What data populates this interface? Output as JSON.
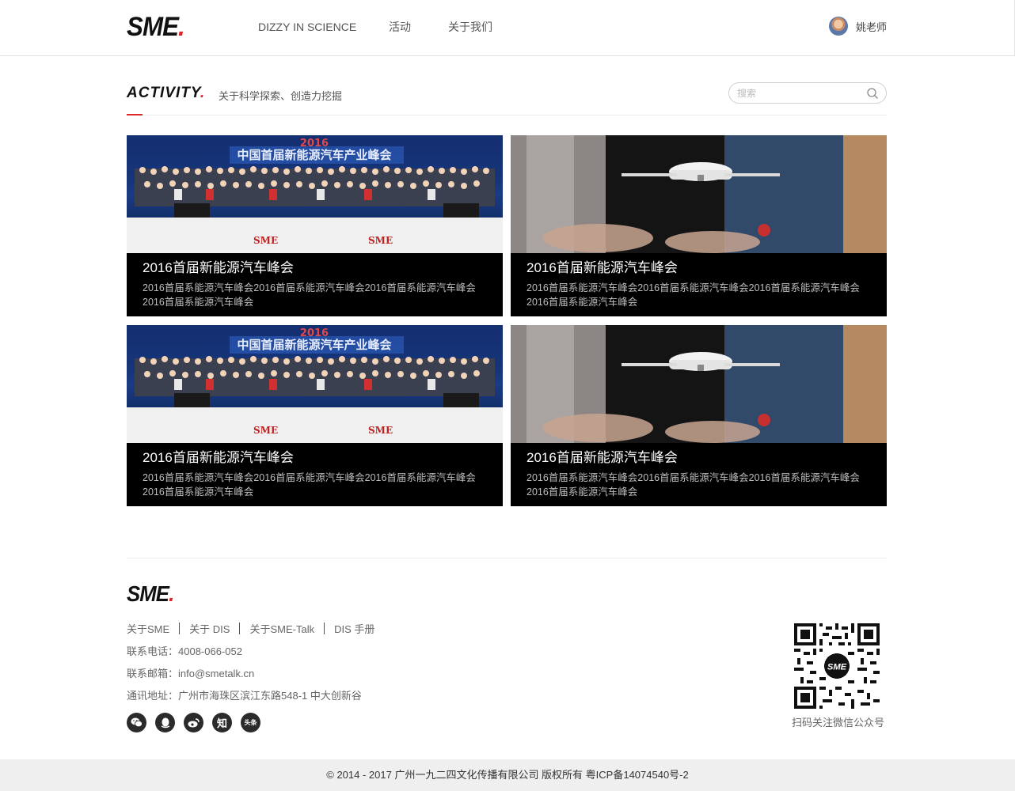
{
  "header": {
    "logo_text": "SME",
    "logo_dot": ".",
    "nav": [
      "DIZZY IN SCIENCE",
      "活动",
      "关于我们"
    ],
    "user_name": "姚老师"
  },
  "section": {
    "title": "ACTIVITY",
    "title_dot": ".",
    "subtitle": "关于科学探索、创造力挖掘",
    "search_placeholder": "搜索"
  },
  "cards": [
    {
      "title": "2016首届新能源汽车峰会",
      "desc": "2016首届系能源汽车峰会2016首届系能源汽车峰会2016首届系能源汽车峰会2016首届系能源汽车峰会",
      "image": "group-photo"
    },
    {
      "title": "2016首届新能源汽车峰会",
      "desc": "2016首届系能源汽车峰会2016首届系能源汽车峰会2016首届系能源汽车峰会2016首届系能源汽车峰会",
      "image": "drone-photo"
    },
    {
      "title": "2016首届新能源汽车峰会",
      "desc": "2016首届系能源汽车峰会2016首届系能源汽车峰会2016首届系能源汽车峰会2016首届系能源汽车峰会",
      "image": "group-photo"
    },
    {
      "title": "2016首届新能源汽车峰会",
      "desc": "2016首届系能源汽车峰会2016首届系能源汽车峰会2016首届系能源汽车峰会2016首届系能源汽车峰会",
      "image": "drone-photo"
    }
  ],
  "footer": {
    "logo_text": "SME",
    "logo_dot": ".",
    "links": [
      "关于SME",
      "关于 DIS",
      "关于SME-Talk",
      "DIS 手册"
    ],
    "phone": "联系电话：4008-066-052",
    "email": "联系邮箱：info@smetalk.cn",
    "address": "通讯地址：广州市海珠区滨江东路548-1 中大创新谷",
    "social_icons": [
      "wechat-icon",
      "qq-icon",
      "weibo-icon",
      "zhihu-icon",
      "toutiao-icon"
    ],
    "social_glyphs": {
      "zhihu": "知",
      "toutiao": "头条"
    },
    "qr_center": "SME",
    "qr_label": "扫码关注微信公众号",
    "copyright": "© 2014 - 2017 广州一九二四文化传播有限公司   版权所有   粤ICP备14074540号-2"
  },
  "colors": {
    "accent": "#e0262d",
    "card_bg": "#000000",
    "footer_bar": "#efefef"
  }
}
